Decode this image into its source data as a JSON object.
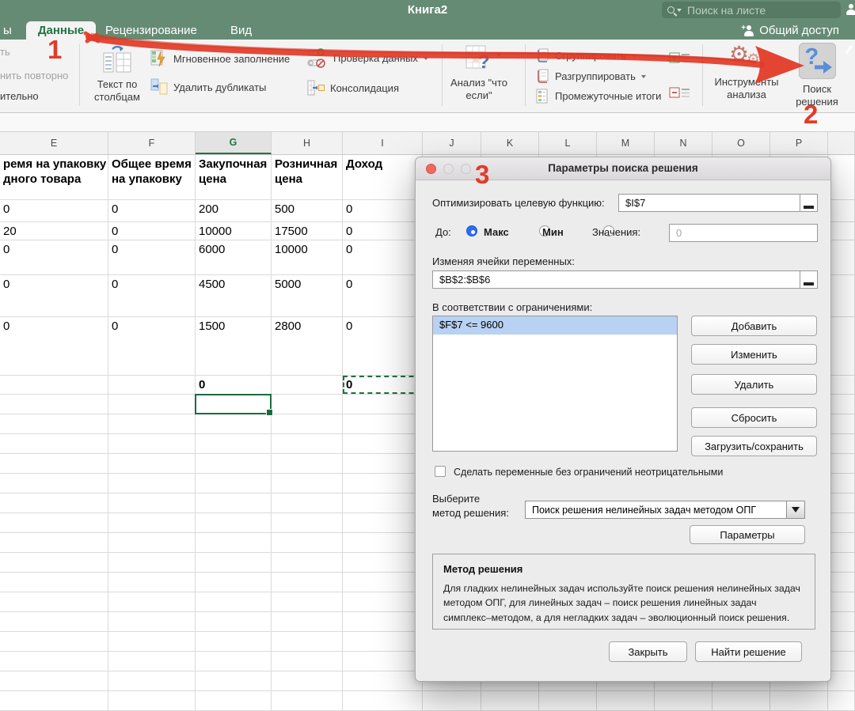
{
  "window": {
    "title": "Книга2",
    "search_placeholder": "Поиск на листе",
    "share_label": "Общий доступ"
  },
  "tabs": {
    "left_fragment": "ы",
    "items": [
      {
        "label": "Данные",
        "active": true
      },
      {
        "label": "Рецензирование",
        "active": false
      },
      {
        "label": "Вид",
        "active": false
      }
    ]
  },
  "ribbon": {
    "left_fragments": [
      "ть",
      "нить повторно",
      "ительно"
    ],
    "text_to_columns": "Текст по\nстолбцам",
    "flash_fill": "Мгновенное заполнение",
    "remove_duplicates": "Удалить дубликаты",
    "data_validation": "Проверка данных",
    "consolidate": "Консолидация",
    "what_if": "Анализ \"что\nесли\"",
    "group": "Сгруппировать",
    "ungroup": "Разгруппировать",
    "subtotal": "Промежуточные итоги",
    "analysis_tools": "Инструменты\nанализа",
    "solver": "Поиск\nрешения"
  },
  "annotations": {
    "n1": "1",
    "n2": "2",
    "n3": "3"
  },
  "sheet": {
    "columns": [
      {
        "letter": "E",
        "w": 137
      },
      {
        "letter": "F",
        "w": 110
      },
      {
        "letter": "G",
        "w": 96,
        "selected": true
      },
      {
        "letter": "H",
        "w": 90
      },
      {
        "letter": "I",
        "w": 101
      },
      {
        "letter": "J",
        "w": 74
      },
      {
        "letter": "K",
        "w": 73
      },
      {
        "letter": "L",
        "w": 73
      },
      {
        "letter": "M",
        "w": 73
      },
      {
        "letter": "N",
        "w": 73
      },
      {
        "letter": "O",
        "w": 73
      },
      {
        "letter": "P",
        "w": 73
      },
      {
        "letter": "",
        "w": 34
      }
    ],
    "rows": [
      {
        "h": 57,
        "cells": {
          "0": {
            "t": "ремя на упаковку\nдного товара",
            "b": 1
          },
          "1": {
            "t": "Общее время\nна упаковку",
            "b": 1
          },
          "2": {
            "t": "Закупочная\nцена",
            "b": 1
          },
          "3": {
            "t": "Розничная\nцена",
            "b": 1
          },
          "4": {
            "t": "Доход",
            "b": 1
          }
        }
      },
      {
        "h": 28,
        "cells": {
          "0": {
            "t": "0"
          },
          "1": {
            "t": "0"
          },
          "2": {
            "t": "200"
          },
          "3": {
            "t": "500"
          },
          "4": {
            "t": "0"
          }
        }
      },
      {
        "h": 23,
        "cells": {
          "0": {
            "t": "20"
          },
          "1": {
            "t": "0"
          },
          "2": {
            "t": "10000"
          },
          "3": {
            "t": "17500"
          },
          "4": {
            "t": "0"
          }
        }
      },
      {
        "h": 44,
        "cells": {
          "0": {
            "t": "0"
          },
          "1": {
            "t": "0"
          },
          "2": {
            "t": "6000"
          },
          "3": {
            "t": "10000"
          },
          "4": {
            "t": "0"
          }
        }
      },
      {
        "h": 53,
        "cells": {
          "0": {
            "t": "0"
          },
          "1": {
            "t": "0"
          },
          "2": {
            "t": "4500"
          },
          "3": {
            "t": "5000"
          },
          "4": {
            "t": "0"
          }
        }
      },
      {
        "h": 74,
        "cells": {
          "0": {
            "t": "0"
          },
          "1": {
            "t": "0"
          },
          "2": {
            "t": "1500"
          },
          "3": {
            "t": "2800"
          },
          "4": {
            "t": "0"
          }
        }
      },
      {
        "h": 24,
        "cells": {
          "2": {
            "t": "0",
            "b": 1
          },
          "4": {
            "t": "0",
            "b": 1,
            "ants": 1
          }
        }
      },
      {
        "h": 25,
        "cells": {},
        "sel_col": 2
      },
      {
        "h": 25,
        "cells": {}
      },
      {
        "h": 25,
        "cells": {}
      },
      {
        "h": 25,
        "cells": {}
      },
      {
        "h": 25,
        "cells": {}
      },
      {
        "h": 25,
        "cells": {}
      },
      {
        "h": 25,
        "cells": {}
      },
      {
        "h": 25,
        "cells": {}
      },
      {
        "h": 25,
        "cells": {}
      },
      {
        "h": 25,
        "cells": {}
      },
      {
        "h": 25,
        "cells": {}
      },
      {
        "h": 25,
        "cells": {}
      },
      {
        "h": 25,
        "cells": {}
      },
      {
        "h": 25,
        "cells": {}
      },
      {
        "h": 25,
        "cells": {}
      },
      {
        "h": 25,
        "cells": {}
      }
    ]
  },
  "dialog": {
    "title": "Параметры поиска решения",
    "objective_label": "Оптимизировать целевую функцию:",
    "objective_value": "$I$7",
    "to_label": "До:",
    "radio_max": "Макс",
    "radio_min": "Мин",
    "radio_value": "Значения:",
    "value_placeholder": "0",
    "variables_label": "Изменяя ячейки переменных:",
    "variables_value": "$B$2:$B$6",
    "constraints_label": "В соответствии с ограничениями:",
    "constraints": [
      "$F$7 <= 9600"
    ],
    "btn_add": "Добавить",
    "btn_change": "Изменить",
    "btn_delete": "Удалить",
    "btn_reset": "Сбросить",
    "btn_load": "Загрузить/сохранить",
    "checkbox_label": "Сделать переменные без ограничений неотрицательными",
    "method_label": "Выберите\nметод решения:",
    "method_value": "Поиск решения нелинейных задач методом ОПГ",
    "btn_options": "Параметры",
    "method_box_title": "Метод решения",
    "method_box_text": "Для гладких нелинейных задач используйте поиск решения нелинейных задач методом ОПГ, для линейных задач – поиск решения линейных задач симплекс–методом, а для негладких задач – эволюционный поиск решения.",
    "btn_close": "Закрыть",
    "btn_solve": "Найти решение"
  },
  "colors": {
    "titlebar_green": "#668b74",
    "excel_green": "#217346",
    "annotation_red": "#e23b27",
    "selection_blue": "#b9d1f2"
  }
}
